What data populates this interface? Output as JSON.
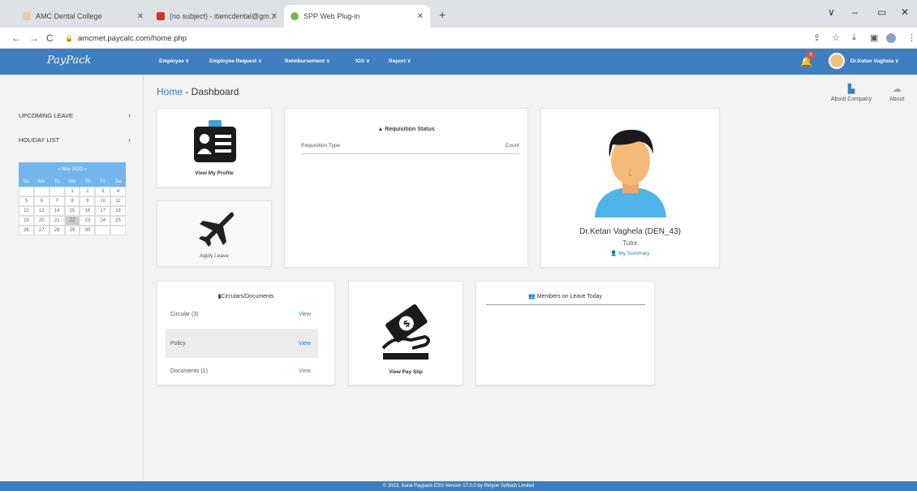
{
  "browser": {
    "tabs": [
      {
        "label": "AMC Dental College",
        "active": false
      },
      {
        "label": "(no subject) - itamcdental@gm...",
        "active": false
      },
      {
        "label": "SPP Web Plug-in",
        "active": true
      }
    ],
    "url": "amcmet.paycalc.com/home.php"
  },
  "header": {
    "logo": "PayPack",
    "menu": [
      "Employee ∨",
      "Employee Request ∨",
      "Reimbursement ∨",
      "IOS ∨",
      "Report ∨"
    ],
    "notification_count": "9",
    "user": "Dr.Ketan Vaghela ∨"
  },
  "sidebar": {
    "items": [
      {
        "label": "UPCOMING LEAVE"
      },
      {
        "label": "HOLIDAY LIST"
      }
    ],
    "calendar": {
      "month": "«  Nov 2023  »",
      "days_of_week": [
        "Su",
        "Mo",
        "Tu",
        "We",
        "Th",
        "Fr",
        "Sa"
      ],
      "cells": [
        "",
        "",
        "",
        "1",
        "2",
        "3",
        "4",
        "5",
        "6",
        "7",
        "8",
        "9",
        "10",
        "11",
        "12",
        "13",
        "14",
        "15",
        "16",
        "17",
        "18",
        "19",
        "20",
        "21",
        "22",
        "23",
        "24",
        "25",
        "26",
        "27",
        "28",
        "29",
        "30",
        "",
        ""
      ],
      "today": "22"
    }
  },
  "main": {
    "breadcrumb_home": "Home",
    "breadcrumb_page": " - Dashboard",
    "top_links": [
      {
        "label": "About Company",
        "icon": "building-icon"
      },
      {
        "label": "About",
        "icon": "cloud-icon"
      }
    ],
    "tiles": {
      "view_profile": "View My Profile",
      "apply_leave": "Apply Leave",
      "view_payslip": "View Pay Slip"
    },
    "requisition": {
      "title": "Requisition Status",
      "col_type": "Requisition Type",
      "col_count": "Count"
    },
    "profile": {
      "name": "Dr.Ketan Vaghela (DEN_43)",
      "role": "Tutor",
      "summary_link": "My Summary"
    },
    "circulars": {
      "title": "Circulars/Documents",
      "rows": [
        {
          "label": "Circular (3)",
          "action": "View"
        },
        {
          "label": "Policy",
          "action": "View"
        },
        {
          "label": "Documents (1)",
          "action": "View"
        }
      ]
    },
    "members_leave": {
      "title": "Members on Leave Today"
    }
  },
  "footer": "© 2023, Saral Paypack ESS Version 17.0.0 by Relyon Softech Limited"
}
